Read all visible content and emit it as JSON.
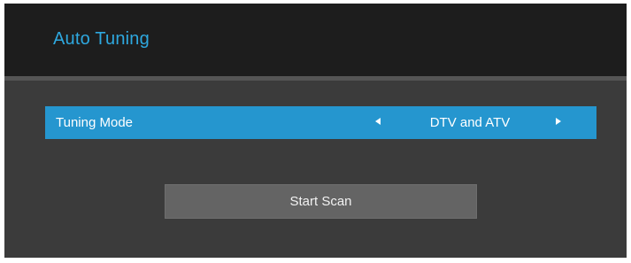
{
  "header": {
    "title": "Auto Tuning"
  },
  "tuning_mode": {
    "label": "Tuning Mode",
    "value": "DTV and ATV"
  },
  "actions": {
    "start_scan_label": "Start Scan"
  },
  "colors": {
    "accent": "#2596cf",
    "title_text": "#2ea8df",
    "header_bg": "#1d1d1d",
    "panel_bg": "#3b3b3b",
    "button_bg": "#646464"
  },
  "icons": {
    "previous": "arrow-left-icon",
    "next": "arrow-right-icon"
  }
}
